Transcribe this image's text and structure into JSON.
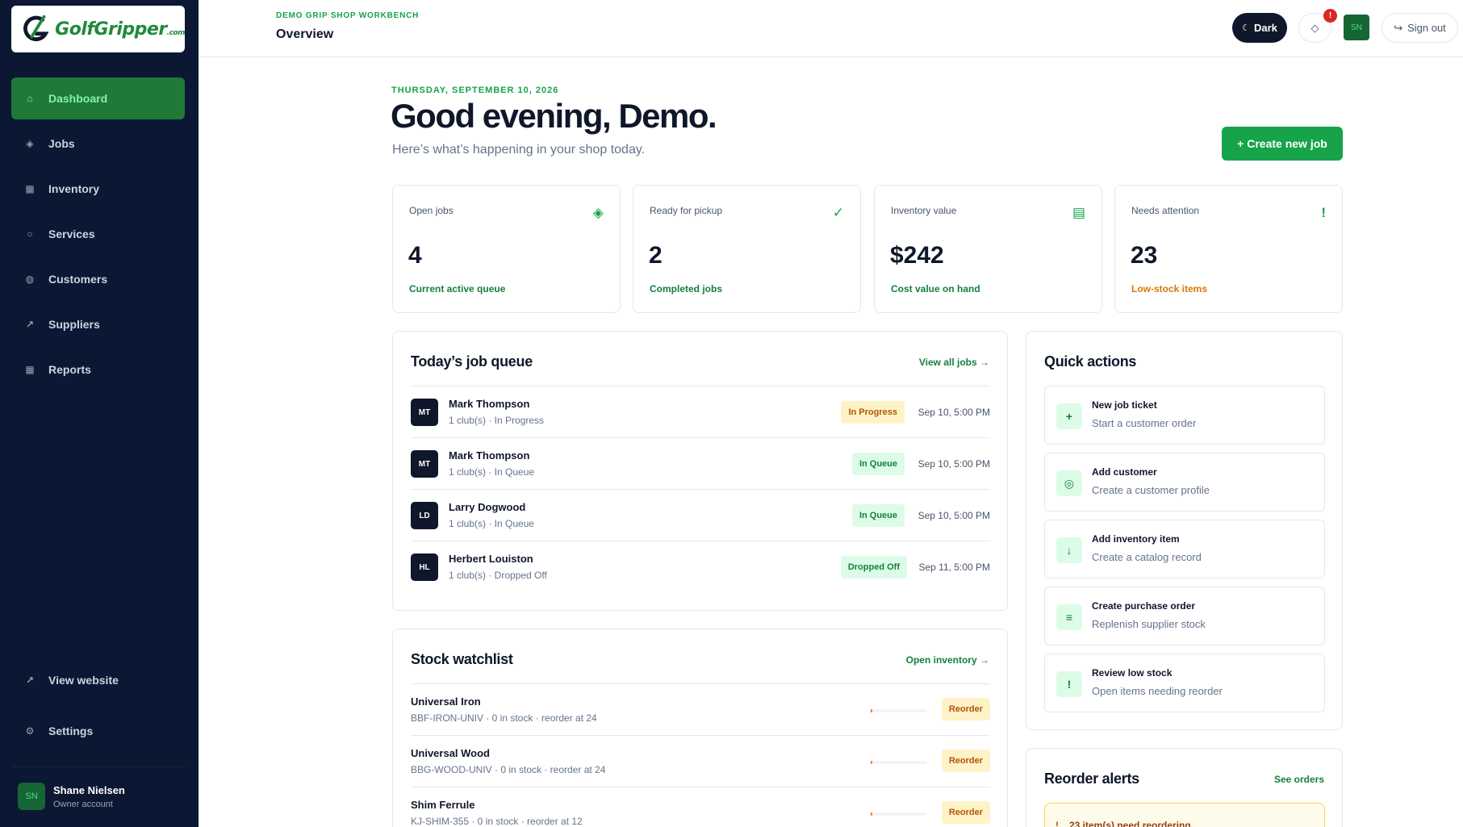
{
  "brand": {
    "name": "GolfGripper",
    "suffix": ".com"
  },
  "header": {
    "kicker": "DEMO GRIP SHOP WORKBENCH",
    "title": "Overview",
    "theme_label": "Dark",
    "notification_count": "!",
    "avatar_initials": "SN",
    "sign_out_label": "Sign out"
  },
  "sidebar": {
    "items": [
      {
        "label": "Dashboard",
        "icon": "home-icon",
        "active": true
      },
      {
        "label": "Jobs",
        "icon": "diamond-icon"
      },
      {
        "label": "Inventory",
        "icon": "grid-icon"
      },
      {
        "label": "Services",
        "icon": "circle-icon"
      },
      {
        "label": "Customers",
        "icon": "user-icon"
      },
      {
        "label": "Suppliers",
        "icon": "arrow-icon"
      },
      {
        "label": "Reports",
        "icon": "chart-icon"
      }
    ],
    "bottom": [
      {
        "label": "View website",
        "icon": "external-icon"
      },
      {
        "label": "Settings",
        "icon": "gear-icon"
      }
    ],
    "user": {
      "initials": "SN",
      "name": "Shane Nielsen",
      "role": "Owner account"
    }
  },
  "main": {
    "date": "THURSDAY, SEPTEMBER 10, 2026",
    "greeting": "Good evening, Demo.",
    "subtitle": "Here’s what’s happening in your shop today.",
    "create_label": "+ Create new job"
  },
  "stats": [
    {
      "label": "Open jobs",
      "value": "4",
      "note": "Current active queue",
      "icon": "◈"
    },
    {
      "label": "Ready for pickup",
      "value": "2",
      "note": "Completed jobs",
      "icon": "✓"
    },
    {
      "label": "Inventory value",
      "value": "$242",
      "note": "Cost value on hand",
      "icon": "▤"
    },
    {
      "label": "Needs attention",
      "value": "23",
      "note": "Low-stock items",
      "icon": "!"
    }
  ],
  "job_queue": {
    "title": "Today’s job queue",
    "link": "View all jobs →",
    "rows": [
      {
        "initials": "MT",
        "name": "Mark Thompson",
        "sub": "1 club(s) · In Progress",
        "status": "In Progress",
        "time": "Sep 10, 5:00 PM"
      },
      {
        "initials": "MT",
        "name": "Mark Thompson",
        "sub": "1 club(s) · In Queue",
        "status": "In Queue",
        "time": "Sep 10, 5:00 PM"
      },
      {
        "initials": "LD",
        "name": "Larry Dogwood",
        "sub": "1 club(s) · In Queue",
        "status": "In Queue",
        "time": "Sep 10, 5:00 PM"
      },
      {
        "initials": "HL",
        "name": "Herbert Louiston",
        "sub": "1 club(s) · Dropped Off",
        "status": "Dropped Off",
        "time": "Sep 11, 5:00 PM"
      }
    ]
  },
  "stock": {
    "title": "Stock watchlist",
    "link": "Open inventory →",
    "rows": [
      {
        "name": "Universal Iron",
        "sub": "BBF-IRON-UNIV · 0 in stock · reorder at 24",
        "action": "Reorder",
        "level": 0.03
      },
      {
        "name": "Universal Wood",
        "sub": "BBG-WOOD-UNIV · 0 in stock · reorder at 24",
        "action": "Reorder",
        "level": 0.03
      },
      {
        "name": "Shim Ferrule",
        "sub": "KJ-SHIM-355 · 0 in stock · reorder at 12",
        "action": "Reorder",
        "level": 0.03
      }
    ]
  },
  "quick_actions": {
    "title": "Quick actions",
    "items": [
      {
        "title": "New job ticket",
        "sub": "Start a customer order",
        "icon": "+"
      },
      {
        "title": "Add customer",
        "sub": "Create a customer profile",
        "icon": "◎"
      },
      {
        "title": "Add inventory item",
        "sub": "Create a catalog record",
        "icon": "↓"
      },
      {
        "title": "Create purchase order",
        "sub": "Replenish supplier stock",
        "icon": "≡"
      },
      {
        "title": "Review low stock",
        "sub": "Open items needing reorder",
        "icon": "!"
      }
    ]
  },
  "reorder_alerts": {
    "title": "Reorder alerts",
    "link": "See orders",
    "message": "23 item(s) need reordering"
  }
}
